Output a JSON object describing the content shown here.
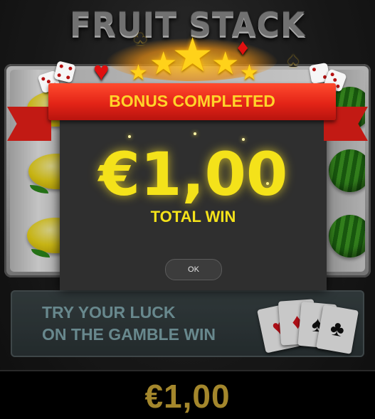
{
  "game": {
    "title": "FRUIT STACK"
  },
  "bonus_dialog": {
    "banner": "BONUS COMPLETED",
    "amount": "€1,00",
    "label": "TOTAL WIN",
    "ok_label": "OK"
  },
  "gamble": {
    "line1": "TRY YOUR LUCK",
    "line2": "ON THE GAMBLE WIN",
    "cards": [
      "heart-icon",
      "diamond-icon",
      "spade-icon",
      "club-icon"
    ]
  },
  "bottom_bar": {
    "balance": "€1,00"
  },
  "colors": {
    "win_text": "#f4e21a",
    "banner": "#e32417",
    "bottom_amount": "#c8a536",
    "gamble_text": "#7fa7ad"
  }
}
